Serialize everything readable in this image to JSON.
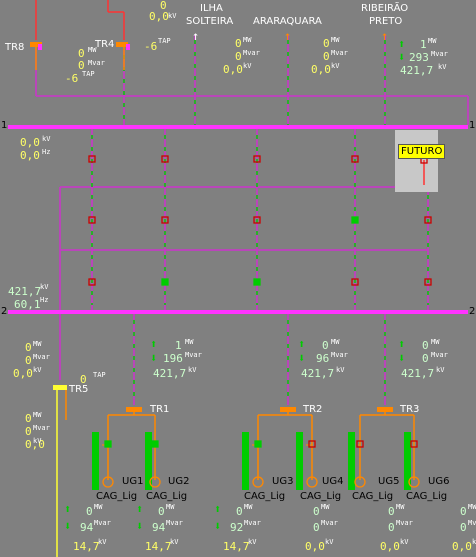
{
  "buses": {
    "bus1_left": "1",
    "bus1_right": "1",
    "bus2_left": "2",
    "bus2_right": "2"
  },
  "top": {
    "line_labels": [
      "ILHA\nSOLTEIRA",
      "ARARAQUARA",
      "RIBEIRÃO\nPRETO"
    ],
    "ilha_l1": "ILHA",
    "ilha_l2": "SOLTEIRA",
    "araraquara": "ARARAQUARA",
    "ribeirao_l1": "RIBEIRÃO",
    "ribeirao_l2": "PRETO",
    "top_mw_0": "0",
    "top_kv_0": "0,0",
    "tr8_label": "TR8",
    "tr4_label": "TR4",
    "tr8_tap": "-6",
    "tr4_tap": "-6",
    "tap_unit": "TAP",
    "tr8_mw": "0",
    "tr8_mvar": "0",
    "ilha_mw": "0",
    "ilha_mvar": "0",
    "ilha_kv": "0,0",
    "arar_mw": "0",
    "arar_mvar": "0",
    "arar_kv": "0,0",
    "rib_mw": "1",
    "rib_mvar": "293",
    "rib_kv": "421,7"
  },
  "bus1": {
    "kv": "0,0",
    "hz": "0,0"
  },
  "bus2": {
    "kv": "421,7",
    "hz": "60,1"
  },
  "futuro": "FUTURO",
  "transformers": {
    "tr5": {
      "label": "TR5",
      "mw": "0",
      "mvar": "0",
      "kv": "0,0",
      "tap": "0"
    },
    "tr1": {
      "label": "TR1",
      "mw": "1",
      "mvar": "196",
      "kv": "421,7"
    },
    "tr2": {
      "label": "TR2",
      "mw": "0",
      "mvar": "96",
      "kv": "421,7"
    },
    "tr3": {
      "label": "TR3",
      "mw": "0",
      "mvar": "0",
      "kv": "421,7"
    },
    "tr5_mvar_b": "0",
    "tr5_kv_b": "0,0"
  },
  "units": [
    {
      "name": "UG1",
      "cag": "CAG_Lig",
      "mw": "0",
      "mvar": "94",
      "kv": "14,7"
    },
    {
      "name": "UG2",
      "cag": "CAG_Lig",
      "mw": "0",
      "mvar": "94",
      "kv": "14,7"
    },
    {
      "name": "UG3",
      "cag": "CAG_Lig",
      "mw": "0",
      "mvar": "92",
      "kv": "14,7"
    },
    {
      "name": "UG4",
      "cag": "CAG_Lig",
      "mw": "0",
      "mvar": "0",
      "kv": "0,0"
    },
    {
      "name": "UG5",
      "cag": "CAG_Lig",
      "mw": "0",
      "mvar": "0",
      "kv": "0,0"
    },
    {
      "name": "UG6",
      "cag": "CAG_Lig",
      "mw": "0",
      "mvar": "0",
      "kv": "0,0"
    }
  ],
  "unit_labels": {
    "mw": "MW",
    "mvar": "Mvar",
    "kv": "kV",
    "hz": "Hz"
  },
  "colors": {
    "bus": "#ff33ff",
    "line": "#cc33cc",
    "feeder_dash": "#00cc00",
    "breaker_open": "#cc0000",
    "breaker_closed": "#00cc00",
    "transformer": "#ff8800",
    "generator_bar": "#00cc00",
    "value": "#ffff66",
    "background": "#808080"
  }
}
